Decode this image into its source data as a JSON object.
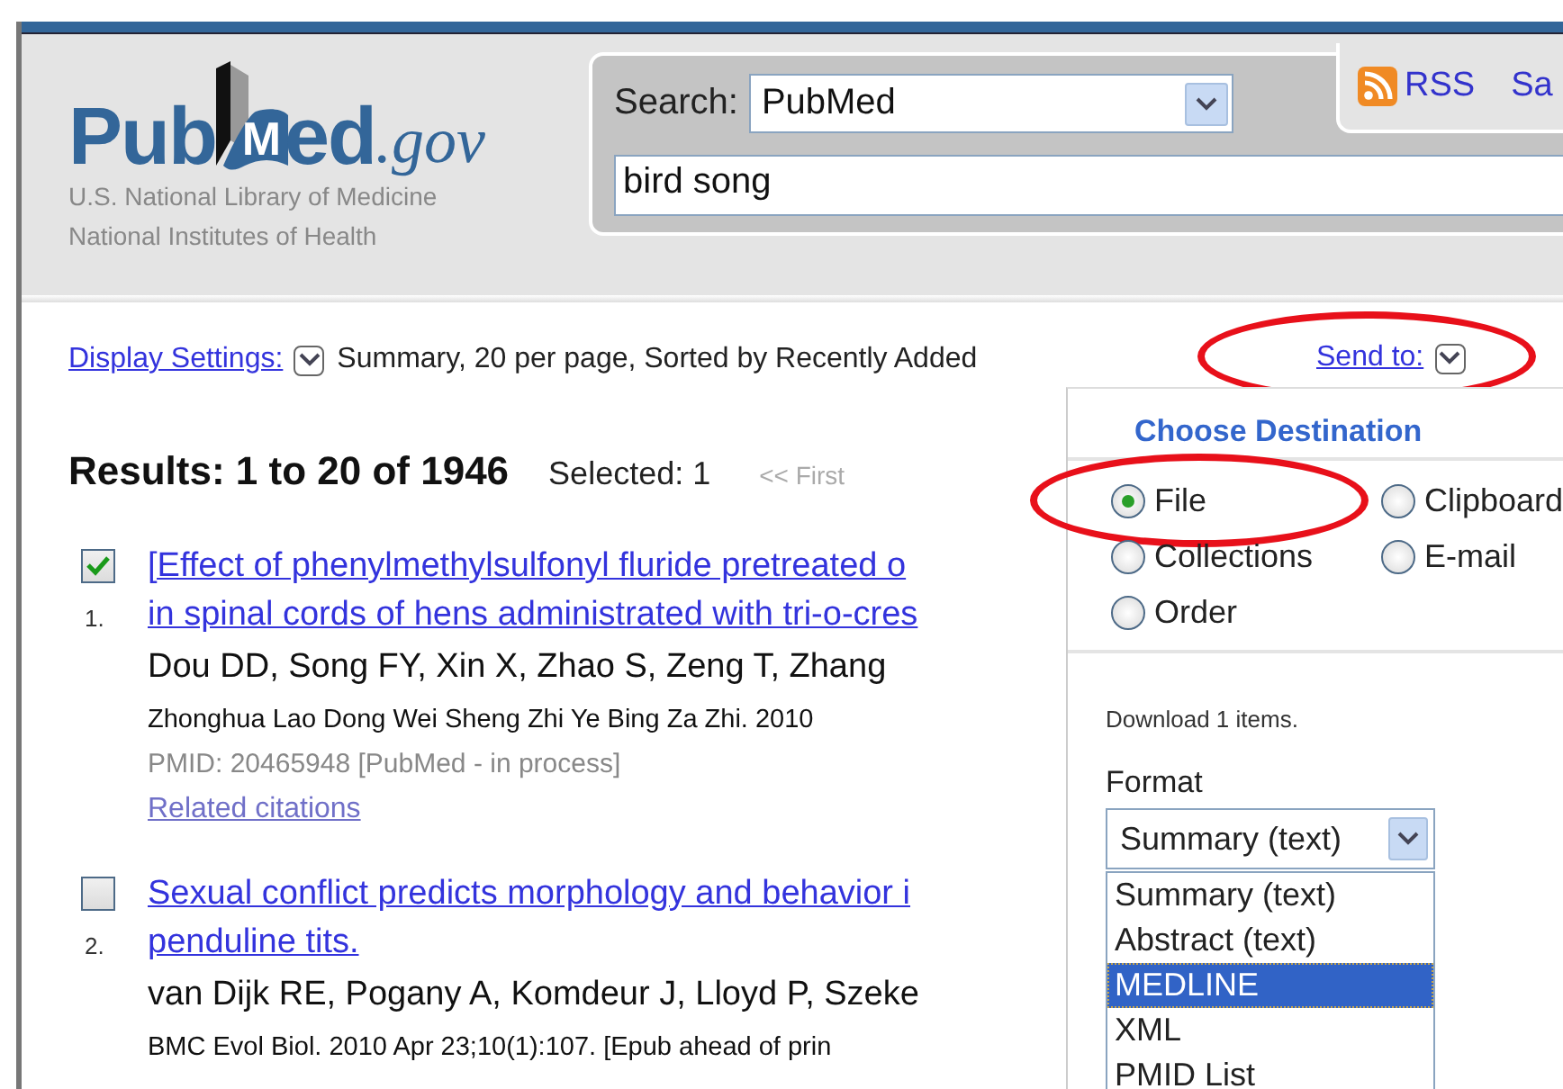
{
  "logo": {
    "name_start": "Pub",
    "book_letter": "M",
    "name_end": "ed",
    "domain": ".gov",
    "lines": [
      "U.S. National Library of Medicine",
      "National Institutes of Health"
    ]
  },
  "search": {
    "label": "Search:",
    "database": "PubMed",
    "query": "bird song"
  },
  "header_links": [
    {
      "kind": "feed",
      "label": "RSS"
    },
    {
      "kind": "plain",
      "label": "Sa"
    }
  ],
  "display_settings": {
    "link": "Display Settings:",
    "summary": "Summary, 20 per page, Sorted by Recently Added"
  },
  "send_to": {
    "label": "Send to:",
    "circled": true
  },
  "results": {
    "heading": "Results: 1 to 20 of 1946",
    "selected": "Selected: 1",
    "first": "<< First"
  },
  "items": [
    {
      "number": "1.",
      "checked": true,
      "title_lines": [
        "[Effect of phenylmethylsulfonyl fluride pretreated o",
        "in spinal cords of hens administrated with tri-o-cres"
      ],
      "authors": "Dou DD, Song FY, Xin X, Zhao S, Zeng T, Zhang",
      "journal": "Zhonghua Lao Dong Wei Sheng Zhi Ye Bing Za Zhi. 2010",
      "pmid": "PMID: 20465948 [PubMed - in process]",
      "related": "Related citations"
    },
    {
      "number": "2.",
      "checked": false,
      "title_lines": [
        "Sexual conflict predicts morphology and behavior i",
        "penduline tits."
      ],
      "authors": "van Dijk RE, Pogany A, Komdeur J, Lloyd P, Szeke",
      "journal": "BMC Evol Biol. 2010 Apr 23;10(1):107. [Epub ahead of prin"
    }
  ],
  "send_menu": {
    "heading": "Choose Destination",
    "destinations": [
      {
        "label": "File",
        "selected": true,
        "circled": true
      },
      {
        "label": "Clipboard",
        "selected": false,
        "circled": false
      },
      {
        "label": "Collections",
        "selected": false,
        "circled": false
      },
      {
        "label": "E-mail",
        "selected": false,
        "circled": false
      },
      {
        "label": "Order",
        "selected": false,
        "circled": false
      }
    ],
    "note": "Download 1 items.",
    "format_label": "Format",
    "format_value": "Summary (text)",
    "format_options": [
      {
        "label": "Summary (text)",
        "selected": false
      },
      {
        "label": "Abstract (text)",
        "selected": false
      },
      {
        "label": "MEDLINE",
        "selected": true
      },
      {
        "label": "XML",
        "selected": false
      },
      {
        "label": "PMID List",
        "selected": false
      }
    ]
  }
}
